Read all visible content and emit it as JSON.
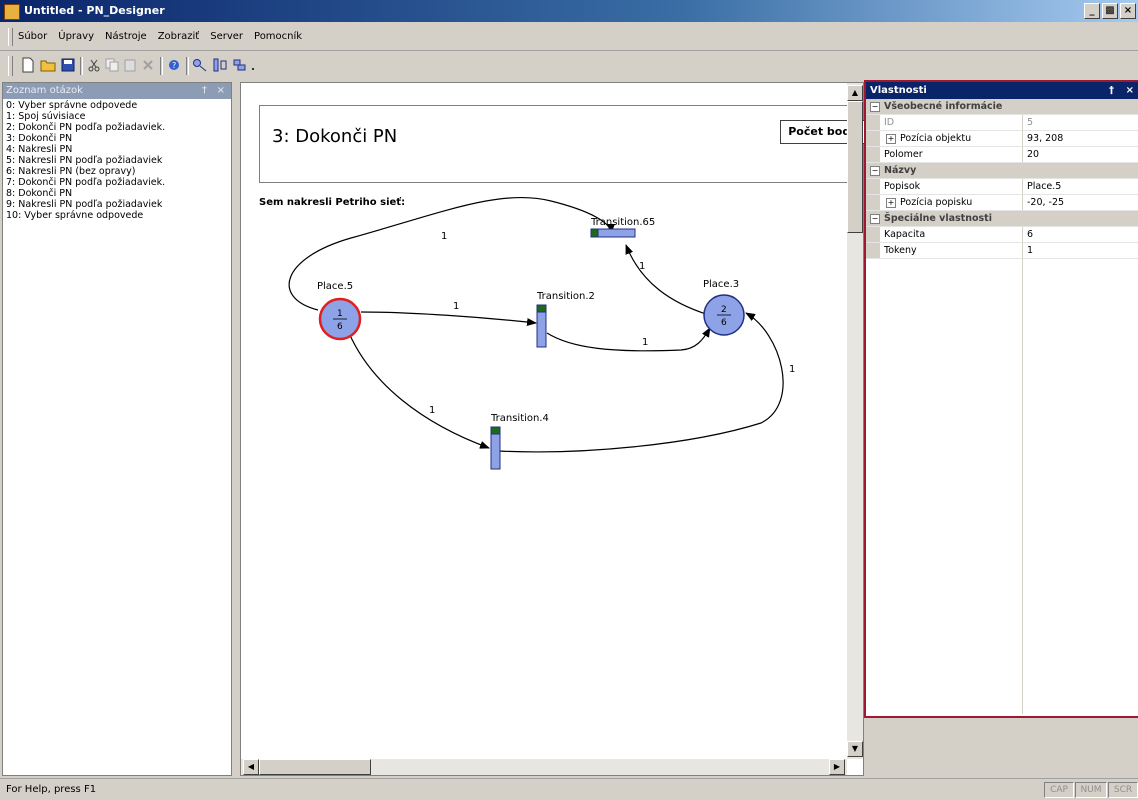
{
  "window": {
    "title": "Untitled - PN_Designer"
  },
  "menu": {
    "items": [
      "Súbor",
      "Úpravy",
      "Nástroje",
      "Zobraziť",
      "Server",
      "Pomocník"
    ]
  },
  "toolbar": {
    "icons": [
      "new-icon",
      "open-icon",
      "save-icon",
      "cut-icon",
      "copy-icon",
      "paste-icon",
      "delete-icon",
      "help-icon",
      "place-tool-icon",
      "transition-tool-icon",
      "arc-tool-icon"
    ]
  },
  "left_panel": {
    "title": "Zoznam otázok",
    "items": [
      "0: Vyber správne odpovede",
      "1: Spoj súvisiace",
      "2: Dokonči PN podľa požiadaviek.",
      "3: Dokonči PN",
      "4: Nakresli PN",
      "5: Nakresli PN podľa požiadaviek",
      "6: Nakresli PN (bez opravy)",
      "7: Dokonči PN podľa požiadaviek.",
      "8: Dokonči PN",
      "9: Nakresli PN podľa požiadaviek",
      "10: Vyber správne odpovede"
    ]
  },
  "question": {
    "title": "3: Dokonči PN",
    "score_button": "Počet bodo",
    "instruction": "Sem nakresli Petriho sieť:"
  },
  "diagram": {
    "places": [
      {
        "name": "Place.5",
        "tokens": "1",
        "capacity": "6",
        "selected": true
      },
      {
        "name": "Place.3",
        "tokens": "2",
        "capacity": "6",
        "selected": false
      }
    ],
    "transitions": [
      "Transition.65",
      "Transition.2",
      "Transition.4"
    ],
    "arc_weights": [
      "1",
      "1",
      "1",
      "1",
      "1",
      "1"
    ]
  },
  "properties": {
    "title": "Vlastnosti",
    "categories": [
      {
        "name": "Všeobecné informácie",
        "rows": [
          {
            "name": "ID",
            "value": "5",
            "grey": true,
            "expandable": false
          },
          {
            "name": "Pozícia objektu",
            "value": "93, 208",
            "grey": false,
            "expandable": true
          },
          {
            "name": "Polomer",
            "value": "20",
            "grey": false,
            "expandable": false
          }
        ]
      },
      {
        "name": "Názvy",
        "rows": [
          {
            "name": "Popisok",
            "value": "Place.5",
            "grey": false,
            "expandable": false
          },
          {
            "name": "Pozícia popisku",
            "value": "-20, -25",
            "grey": false,
            "expandable": true
          }
        ]
      },
      {
        "name": "Špeciálne vlastnosti",
        "rows": [
          {
            "name": "Kapacita",
            "value": "6",
            "grey": false,
            "expandable": false
          },
          {
            "name": "Tokeny",
            "value": "1",
            "grey": false,
            "expandable": false
          }
        ]
      }
    ]
  },
  "status": {
    "text": "For Help, press F1",
    "indicators": [
      "CAP",
      "NUM",
      "SCR"
    ]
  },
  "colors": {
    "place_fill": "#8ea2e8",
    "selected_border": "#e02020",
    "panel_border": "#a01830",
    "transition_fill": "#8ea2e8",
    "transition_top": "#1c6a1c"
  }
}
